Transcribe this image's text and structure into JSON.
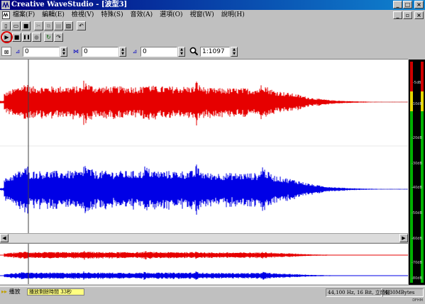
{
  "window": {
    "title": "Creative WaveStudio - [波型3]",
    "controls": [
      "_",
      "□",
      "×"
    ],
    "mdi_controls": [
      "_",
      "▫",
      "×"
    ]
  },
  "menu": [
    "檔案(F)",
    "編輯(E)",
    "檢視(V)",
    "特殊(S)",
    "音效(A)",
    "選項(O)",
    "視窗(W)",
    "說明(H)"
  ],
  "toolbar1": [
    {
      "name": "new-file-icon",
      "glyph": "▯",
      "enabled": true
    },
    {
      "name": "open-folder-icon",
      "glyph": "▭",
      "enabled": true
    },
    {
      "name": "save-disk-icon",
      "glyph": "■",
      "enabled": true
    },
    {
      "name": "cut-icon",
      "glyph": "✂",
      "enabled": false
    },
    {
      "name": "copy-icon",
      "glyph": "⧉",
      "enabled": false
    },
    {
      "name": "paste-icon",
      "glyph": "▤",
      "enabled": false
    },
    {
      "name": "delete-icon",
      "glyph": "▨",
      "enabled": true
    },
    {
      "name": "undo-icon",
      "glyph": "↶",
      "enabled": true
    }
  ],
  "transport": [
    {
      "name": "play-icon",
      "glyph": "▶"
    },
    {
      "name": "stop-icon",
      "glyph": "■"
    },
    {
      "name": "pause-icon",
      "glyph": "❚❚"
    },
    {
      "name": "record-icon",
      "glyph": "●"
    },
    {
      "name": "loop-icon",
      "glyph": "↻"
    },
    {
      "name": "forward-icon",
      "glyph": "↷"
    }
  ],
  "positions": {
    "start": "0",
    "end": "0",
    "length": "0",
    "zoom": "1:1097"
  },
  "meter_labels": [
    "-5dB",
    "-10dB",
    "-20dB",
    "-30dB",
    "-40dB",
    "-50dB",
    "-60dB",
    "-70dB",
    "-80dB"
  ],
  "status": {
    "arrows": "▸▸",
    "left_text": "播放",
    "progress_text": "播放剩餘時間 33秒",
    "format": "44,100 Hz, 16 Bit, 立體聲",
    "size": "4.30MBytes",
    "sub": "DFHM"
  },
  "colors": {
    "left_channel": "#e60000",
    "right_channel": "#0000e6"
  }
}
